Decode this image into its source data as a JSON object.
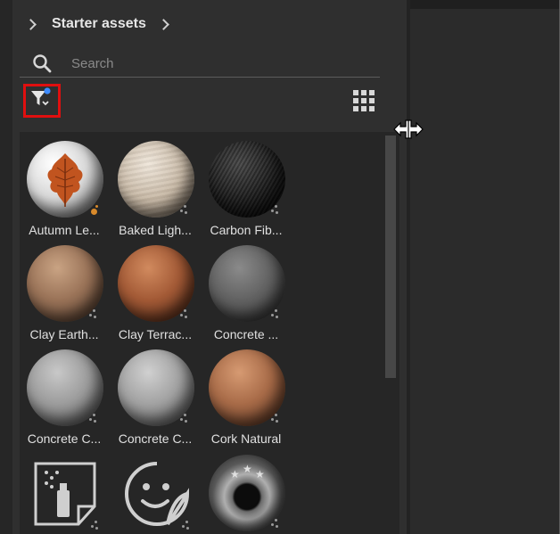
{
  "breadcrumb": {
    "label": "Starter assets"
  },
  "search": {
    "placeholder": "Search"
  },
  "assets": [
    {
      "label": "Autumn Le..."
    },
    {
      "label": "Baked Ligh..."
    },
    {
      "label": "Carbon Fib..."
    },
    {
      "label": "Clay Earth..."
    },
    {
      "label": "Clay Terrac..."
    },
    {
      "label": "Concrete ..."
    },
    {
      "label": "Concrete C..."
    },
    {
      "label": "Concrete C..."
    },
    {
      "label": "Cork Natural"
    },
    {
      "label": ""
    },
    {
      "label": ""
    },
    {
      "label": ""
    }
  ],
  "icons": {
    "filter": "filter-icon",
    "grid_view": "grid-view-icon",
    "search": "search-icon",
    "resize_cursor": "resize-cursor-icon"
  },
  "colors": {
    "highlight": "#e00f0f",
    "filter_dot": "#3d8bff",
    "favorite_badge": "#d98a2b"
  }
}
